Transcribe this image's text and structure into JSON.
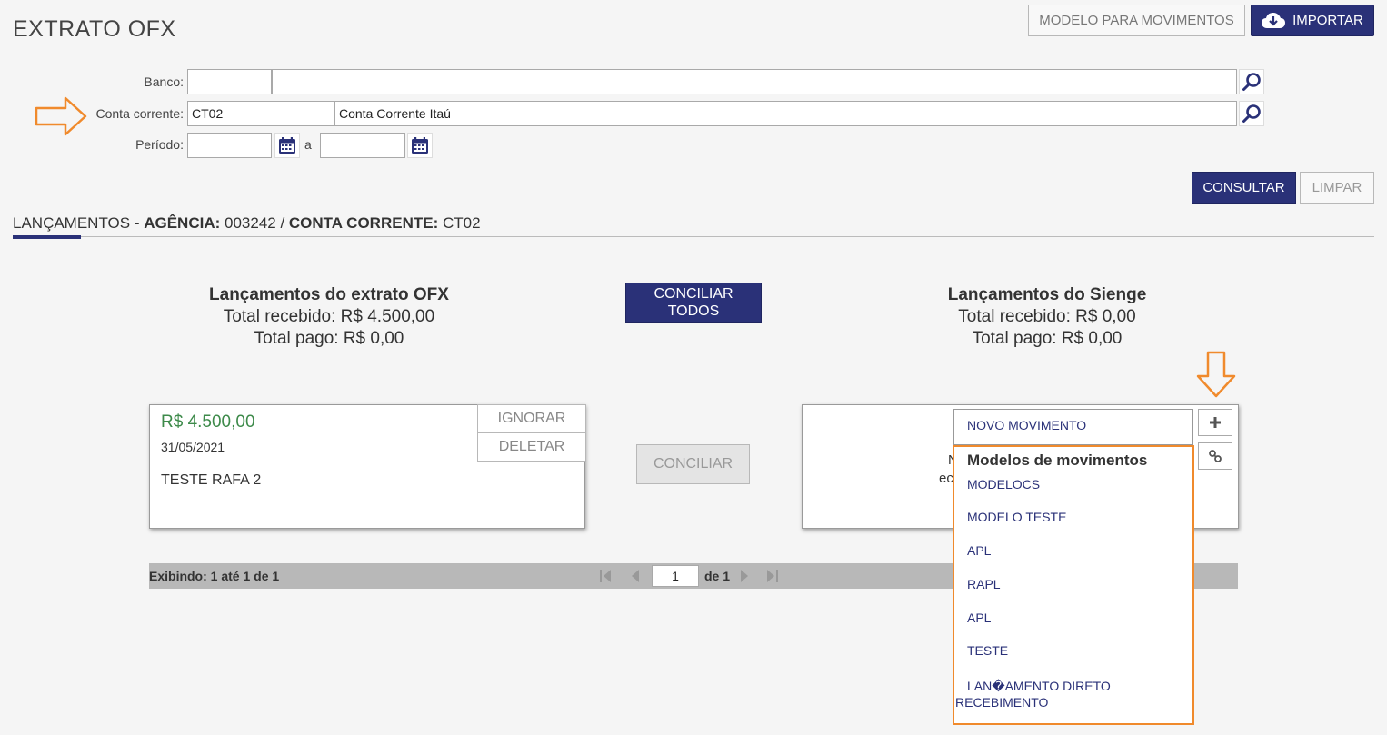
{
  "header": {
    "title": "EXTRATO OFX",
    "modelo_button": "MODELO PARA MOVIMENTOS",
    "importar_button": "IMPORTAR"
  },
  "filters": {
    "banco_label": "Banco:",
    "banco_code": "",
    "banco_name": "",
    "conta_label": "Conta corrente:",
    "conta_code": "CT02",
    "conta_name": "Conta Corrente Itaú",
    "periodo_label": "Período:",
    "periodo_from": "",
    "periodo_sep": "a",
    "periodo_to": ""
  },
  "actions": {
    "consultar": "CONSULTAR",
    "limpar": "LIMPAR"
  },
  "section": {
    "tab_label": "LANÇAMENTOS",
    "dash": " - ",
    "agencia_label": "AGÊNCIA:",
    "agencia_value": " 003242 / ",
    "conta_label": "CONTA CORRENTE:",
    "conta_value": " CT02"
  },
  "ofx": {
    "title": "Lançamentos do extrato OFX",
    "recebido": "Total recebido: R$ 4.500,00",
    "pago": "Total pago: R$ 0,00"
  },
  "conciliar_todos": {
    "line1": "CONCILIAR",
    "line2": "TODOS"
  },
  "sienge": {
    "title": "Lançamentos do Sienge",
    "recebido": "Total recebido: R$ 0,00",
    "pago": "Total pago: R$ 0,00"
  },
  "entry": {
    "amount": "R$ 4.500,00",
    "date": "31/05/2021",
    "description": "TESTE RAFA 2",
    "ignorar": "IGNORAR",
    "deletar": "DELETAR"
  },
  "conciliar_button": "CONCILIAR",
  "sienge_card": {
    "partial_line1": "N",
    "partial_line2": "ec"
  },
  "dropdown": {
    "novo_movimento": "NOVO MOVIMENTO",
    "group_title": "Modelos de movimentos",
    "items": [
      "MODELOCS",
      "MODELO TESTE",
      "APL",
      "RAPL",
      "APL",
      "TESTE"
    ],
    "last_item_line1": "LAN�AMENTO DIRETO",
    "last_item_line2": "RECEBIMENTO"
  },
  "pagination": {
    "showing": "Exibindo: 1 até 1 de 1",
    "page": "1",
    "of": "de 1"
  },
  "colors": {
    "primary": "#2a3178",
    "amount_green": "#3d8a4a",
    "highlight_orange": "#f08a2c"
  }
}
